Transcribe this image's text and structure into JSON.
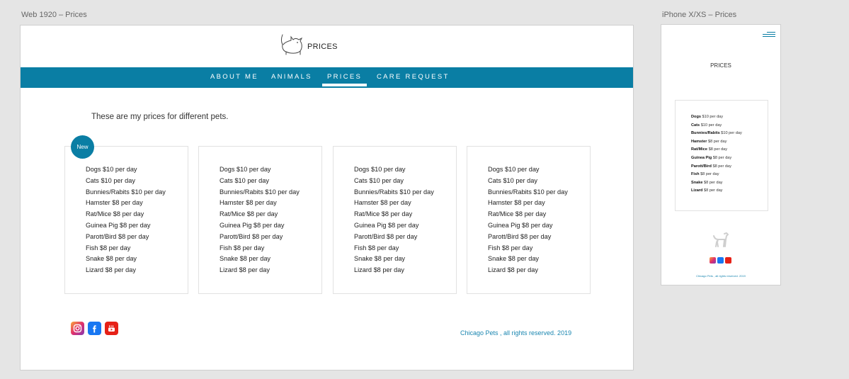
{
  "artboards": {
    "web_label": "Web 1920 – Prices",
    "phone_label": "iPhone X/XS – Prices"
  },
  "web": {
    "logo_text": "PRICES",
    "nav": [
      {
        "label": "ABOUT ME"
      },
      {
        "label": "ANIMALS"
      },
      {
        "label": "PRICES",
        "active": true
      },
      {
        "label": "CARE REQUEST"
      }
    ],
    "intro": "These are my prices for different pets.",
    "badge": "New",
    "price_cards": [
      {
        "items": [
          "Dogs $10 per day",
          "Cats $10 per day",
          "Bunnies/Rabits $10 per day",
          "Hamster $8 per day",
          "Rat/Mice $8 per day",
          "Guinea Pig $8 per day",
          "Parott/Bird $8 per day",
          "Fish $8 per day",
          "Snake $8 per day",
          "Lizard $8 per day"
        ]
      },
      {
        "items": [
          "Dogs $10 per day",
          "Cats $10 per day",
          "Bunnies/Rabits $10 per day",
          "Hamster $8 per day",
          "Rat/Mice $8 per day",
          "Guinea Pig $8 per day",
          "Parott/Bird $8 per day",
          "Fish $8 per day",
          "Snake $8 per day",
          "Lizard $8 per day"
        ]
      },
      {
        "items": [
          "Dogs $10 per day",
          "Cats $10 per day",
          "Bunnies/Rabits $10 per day",
          "Hamster $8 per day",
          "Rat/Mice $8 per day",
          "Guinea Pig $8 per day",
          "Parott/Bird $8 per day",
          "Fish $8 per day",
          "Snake $8 per day",
          "Lizard $8 per day"
        ]
      },
      {
        "items": [
          "Dogs $10 per day",
          "Cats $10 per day",
          "Bunnies/Rabits $10 per day",
          "Hamster $8 per day",
          "Rat/Mice $8 per day",
          "Guinea Pig $8 per day",
          "Parott/Bird $8 per day",
          "Fish $8 per day",
          "Snake $8 per day",
          "Lizard $8 per day"
        ]
      }
    ],
    "social_icons": [
      "instagram-icon",
      "facebook-icon",
      "youtube-icon"
    ],
    "copyright": "Chicago Pets , all rights reserved.   2019"
  },
  "phone": {
    "title": "PRICES",
    "prices": [
      {
        "name": "Dogs",
        "price": "$10 per day"
      },
      {
        "name": "Cats",
        "price": "$10 per day"
      },
      {
        "name": "Bunnies/Rabits",
        "price": "$10 per day"
      },
      {
        "name": "Hamster",
        "price": "$8 per day"
      },
      {
        "name": "Rat/Mice",
        "price": "$8 per day"
      },
      {
        "name": "Guinea Pig",
        "price": "$8 per day"
      },
      {
        "name": "Parott/Bird",
        "price": "$8 per day"
      },
      {
        "name": "Fish",
        "price": "$8 per day"
      },
      {
        "name": "Snake",
        "price": "$8 per day"
      },
      {
        "name": "Lizard",
        "price": "$8 per day"
      }
    ],
    "copyright": "Chicago Pets , all rights reserved.   2019"
  },
  "colors": {
    "brand_blue": "#0a7ea4",
    "link_blue": "#1a86b0",
    "canvas_gray": "#e5e5e5"
  }
}
